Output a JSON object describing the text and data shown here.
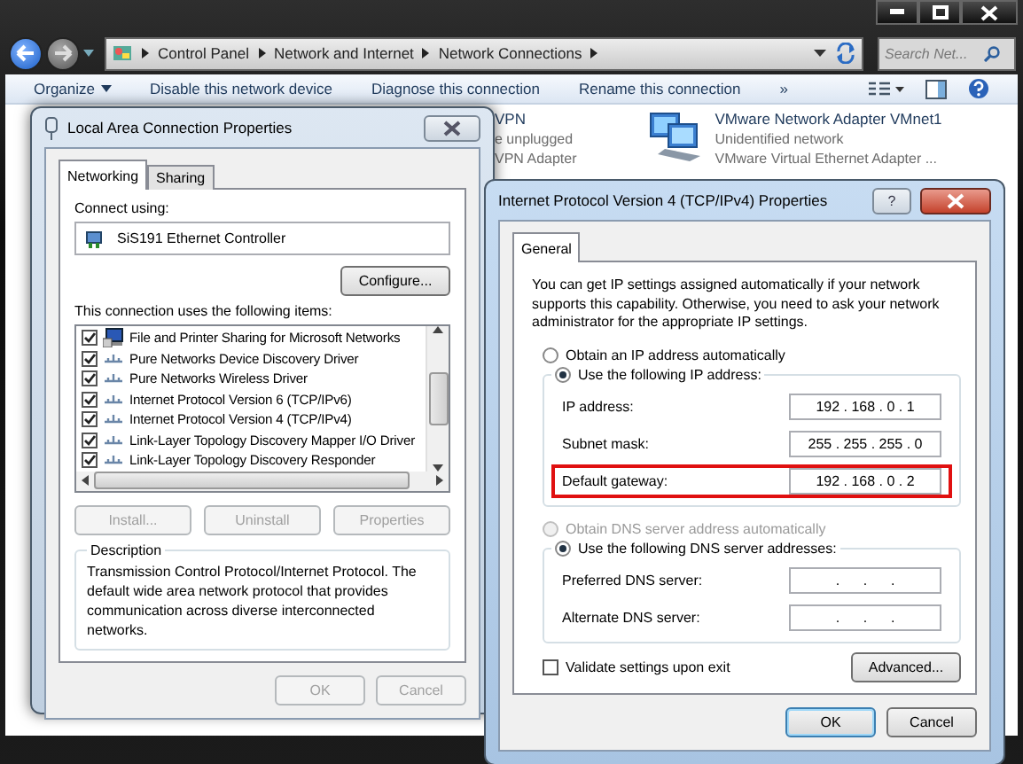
{
  "explorer": {
    "address_path": [
      "Control Panel",
      "Network and Internet",
      "Network Connections"
    ],
    "search": {
      "placeholder": "Search Net..."
    },
    "toolbar": [
      {
        "label": "Organize",
        "kind": "menu"
      },
      {
        "label": "Disable this network device",
        "kind": "command"
      },
      {
        "label": "Diagnose this connection",
        "kind": "command"
      },
      {
        "label": "Rename this connection",
        "kind": "command"
      },
      {
        "label": "»",
        "kind": "more"
      }
    ],
    "connections": [
      {
        "kind": "clipped",
        "lines": [
          "VPN",
          "e unplugged",
          "VPN Adapter"
        ]
      },
      {
        "kind": "adapter",
        "lines": [
          "VMware Network Adapter VMnet1",
          "Unidentified network",
          "VMware Virtual Ethernet Adapter ..."
        ]
      }
    ]
  },
  "lan_dialog": {
    "title": "Local Area Connection Properties",
    "tabs": [
      {
        "label": "Networking",
        "selected": true
      },
      {
        "label": "Sharing",
        "selected": false
      }
    ],
    "connect_using_label": "Connect using:",
    "adapter": "SiS191 Ethernet Controller",
    "configure_button": {
      "label": "Configure...",
      "disabled": false
    },
    "items_label": "This connection uses the following items:",
    "items": [
      {
        "label": "File and Printer Sharing for Microsoft Networks",
        "checked": true,
        "kind": "service"
      },
      {
        "label": "Pure Networks Device Discovery Driver",
        "checked": true,
        "kind": "protocol"
      },
      {
        "label": "Pure Networks Wireless Driver",
        "checked": true,
        "kind": "protocol"
      },
      {
        "label": "Internet Protocol Version 6 (TCP/IPv6)",
        "checked": true,
        "kind": "protocol"
      },
      {
        "label": "Internet Protocol Version 4 (TCP/IPv4)",
        "checked": true,
        "kind": "protocol"
      },
      {
        "label": "Link-Layer Topology Discovery Mapper I/O Driver",
        "checked": true,
        "kind": "protocol"
      },
      {
        "label": "Link-Layer Topology Discovery Responder",
        "checked": true,
        "kind": "protocol"
      }
    ],
    "item_buttons": [
      {
        "label": "Install...",
        "disabled": true
      },
      {
        "label": "Uninstall",
        "disabled": true
      },
      {
        "label": "Properties",
        "disabled": true
      }
    ],
    "description": {
      "title": "Description",
      "text": "Transmission Control Protocol/Internet Protocol. The default wide area network protocol that provides communication across diverse interconnected networks."
    },
    "buttons": [
      {
        "label": "OK",
        "disabled": true
      },
      {
        "label": "Cancel",
        "disabled": true
      }
    ]
  },
  "ipv4_dialog": {
    "title": "Internet Protocol Version 4 (TCP/IPv4) Properties",
    "help_button": "?",
    "tabs": [
      {
        "label": "General",
        "selected": true
      }
    ],
    "intro": "You can get IP settings assigned automatically if your network supports this capability. Otherwise, you need to ask your network administrator for the appropriate IP settings.",
    "ip_mode": [
      {
        "label": "Obtain an IP address automatically",
        "selected": false,
        "disabled": false
      },
      {
        "label": "Use the following IP address:",
        "selected": true,
        "disabled": false
      }
    ],
    "ip_fields": [
      {
        "label": "IP address:",
        "value": "192 . 168 . 0 . 1",
        "highlighted": false
      },
      {
        "label": "Subnet mask:",
        "value": "255 . 255 . 255 . 0",
        "highlighted": false
      },
      {
        "label": "Default gateway:",
        "value": "192 . 168 . 0 . 2",
        "highlighted": true
      }
    ],
    "dns_mode": [
      {
        "label": "Obtain DNS server address automatically",
        "selected": false,
        "disabled": true
      },
      {
        "label": "Use the following DNS server addresses:",
        "selected": true,
        "disabled": false
      }
    ],
    "dns_fields": [
      {
        "label": "Preferred DNS server:",
        "value": ".      .      .",
        "highlighted": false
      },
      {
        "label": "Alternate DNS server:",
        "value": ".      .      .",
        "highlighted": false
      }
    ],
    "validate": {
      "label": "Validate settings upon exit",
      "checked": false
    },
    "advanced_button": "Advanced...",
    "buttons": [
      {
        "label": "OK",
        "default": true
      },
      {
        "label": "Cancel",
        "default": false
      }
    ]
  }
}
